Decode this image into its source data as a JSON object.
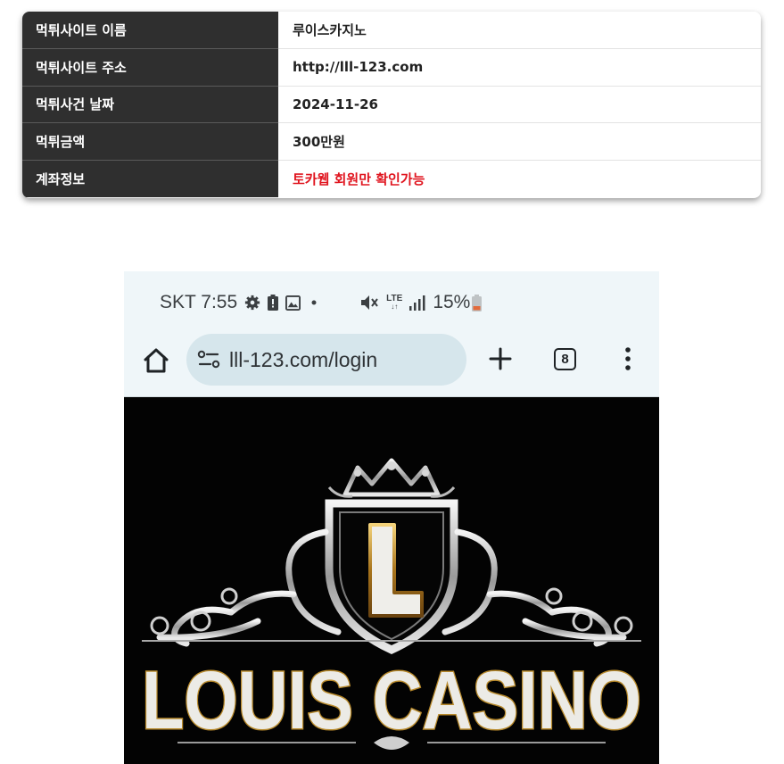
{
  "report": {
    "rows": [
      {
        "label": "먹튀사이트 이름",
        "value": "루이스카지노"
      },
      {
        "label": "먹튀사이트 주소",
        "value": "http://lll-123.com"
      },
      {
        "label": "먹튀사건 날짜",
        "value": "2024-11-26"
      },
      {
        "label": "먹튀금액",
        "value": "300만원"
      },
      {
        "label": "계좌정보",
        "value": "토카웹 회원만 확인가능"
      }
    ],
    "alert_color": "#e0141e"
  },
  "phone": {
    "status": {
      "carrier_time": "SKT 7:55",
      "network": "LTE",
      "battery": "15%"
    },
    "browser": {
      "url": "lll-123.com/login",
      "tab_count": "8"
    },
    "logo": {
      "letter": "L",
      "name": "LOUIS CASINO"
    }
  }
}
